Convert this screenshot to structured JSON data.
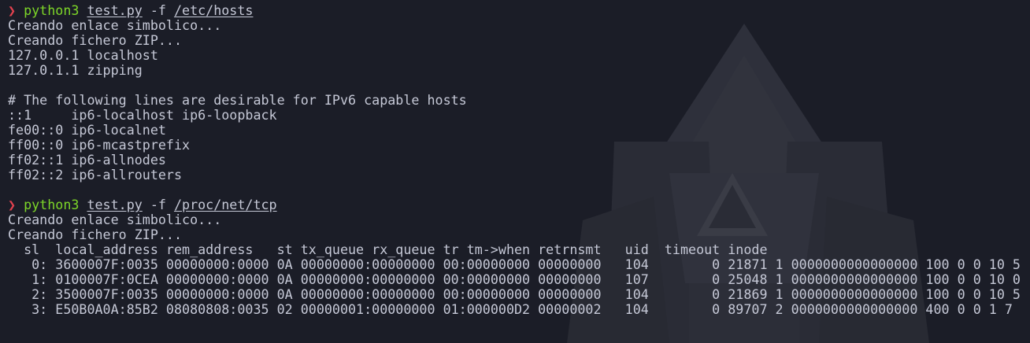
{
  "colors": {
    "background": "#1b1d27",
    "text": "#c5c8d6",
    "prompt_arrow": "#e4424f",
    "command": "#7dd628"
  },
  "blocks": [
    {
      "prompt": {
        "symbol": "❯",
        "command": "python3",
        "script": "test.py",
        "flag": "-f",
        "path": "/etc/hosts"
      },
      "output": [
        "Creando enlace simbolico...",
        "Creando fichero ZIP...",
        "127.0.0.1 localhost",
        "127.0.1.1 zipping",
        "",
        "# The following lines are desirable for IPv6 capable hosts",
        "::1     ip6-localhost ip6-loopback",
        "fe00::0 ip6-localnet",
        "ff00::0 ip6-mcastprefix",
        "ff02::1 ip6-allnodes",
        "ff02::2 ip6-allrouters",
        ""
      ]
    },
    {
      "prompt": {
        "symbol": "❯",
        "command": "python3",
        "script": "test.py",
        "flag": "-f",
        "path": "/proc/net/tcp"
      },
      "output": [
        "Creando enlace simbolico...",
        "Creando fichero ZIP...",
        "  sl  local_address rem_address   st tx_queue rx_queue tr tm->when retrnsmt   uid  timeout inode",
        "   0: 3600007F:0035 00000000:0000 0A 00000000:00000000 00:00000000 00000000   104        0 21871 1 0000000000000000 100 0 0 10 5",
        "   1: 0100007F:0CEA 00000000:0000 0A 00000000:00000000 00:00000000 00000000   107        0 25048 1 0000000000000000 100 0 0 10 0",
        "   2: 3500007F:0035 00000000:0000 0A 00000000:00000000 00:00000000 00000000   104        0 21869 1 0000000000000000 100 0 0 10 5",
        "   3: E50B0A0A:85B2 08080808:0035 02 00000001:00000000 01:000000D2 00000002   104        0 89707 2 0000000000000000 400 0 0 1 7"
      ]
    }
  ]
}
